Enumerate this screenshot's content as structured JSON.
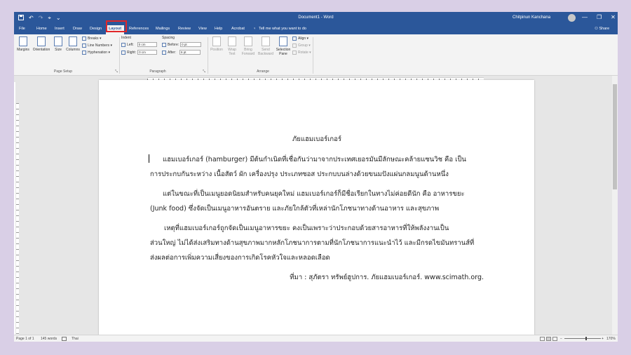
{
  "titlebar": {
    "save_icon": "save-icon",
    "undo_glyph": "↶",
    "redo_glyph": "↷",
    "touch_glyph": "⌖",
    "qa_more_glyph": "⌄",
    "document_title": "Document1 - Word",
    "user_name": "Chitpinun Kanchana",
    "minimize_glyph": "—",
    "maximize_glyph": "❐",
    "close_glyph": "✕"
  },
  "tabs": [
    "File",
    "Home",
    "Insert",
    "Draw",
    "Design",
    "Layout",
    "References",
    "Mailings",
    "Review",
    "View",
    "Help",
    "Acrobat"
  ],
  "active_tab": "Layout",
  "tell_me": {
    "icon": "lightbulb-icon",
    "glyph": "♀",
    "text": "Tell me what you want to do"
  },
  "share": {
    "icon": "person-icon",
    "glyph": "⚇",
    "label": "Share"
  },
  "ribbon": {
    "page_setup": {
      "label": "Page Setup",
      "margins": "Margins",
      "orientation": "Orientation",
      "size": "Size",
      "columns": "Columns",
      "breaks": "Breaks ▾",
      "line_numbers": "Line Numbers ▾",
      "hyphenation": "Hyphenation ▾"
    },
    "paragraph": {
      "label": "Paragraph",
      "indent_label": "Indent",
      "spacing_label": "Spacing",
      "left_label": "Left:",
      "left_value": "0 cm",
      "right_label": "Right:",
      "right_value": "0 cm",
      "before_label": "Before:",
      "before_value": "0 pt",
      "after_label": "After:",
      "after_value": "6 pt"
    },
    "arrange": {
      "label": "Arrange",
      "position": "Position",
      "wrap_text": "Wrap Text",
      "bring_forward": "Bring Forward",
      "send_backward": "Send Backward",
      "selection_pane": "Selection Pane",
      "align": "Align ▾",
      "group": "Group ▾",
      "rotate": "Rotate ▾"
    },
    "launcher_glyph": "⤡"
  },
  "document": {
    "title": "ภัยแฮมเบอร์เกอร์",
    "lines": [
      "แฮมเบอร์เกอร์ (hamburger) มีต้นกำเนิดที่เชื่อกันว่ามาจากประเทศเยอรมันมีลักษณะคล้ายแซนวิช คือ เป็น",
      "การประกบกันระหว่าง เนื้อสัตว์ ผัก เครื่องปรุง ประเภทซอส ประกบบนล่างด้วยขนมปังแผ่นกลมนูนด้านหนึ่ง",
      "แต่ในขณะที่เป็นเมนูยอดนิยมสำหรับคนยุคใหม่ แฮมเบอร์เกอร์ก็มีชื่อเรียกในทางไม่ค่อยดีนัก คือ  อาหารขยะ",
      "(Junk food) ซึ่งจัดเป็นเมนูอาหารอันตราย และภัยใกล้ตัวที่เหล่านักโภชนาทางด้านอาหาร และสุขภาพ",
      "เหตุที่แฮมเบอร์เกอร์ถูกจัดเป็นเมนูอาหารขยะ คงเป็นเพราะว่าประกอบด้วยสารอาหารที่ให้พลังงานเป็น",
      "ส่วนใหญ่ ไม่ได้ส่งเสริมทางด้านสุขภาพมากหลักโภชนาการตามที่นักโภชนาการแนะนำไว้ และมีกรดไขมันทรานส์ที่",
      "ส่งผลต่อการเพิ่มความเสี่ยงของการเกิดโรคหัวใจและหลอดเลือด"
    ],
    "source": "ที่มา : สุภัตรา ทรัพย์ฮูปการ. ภัยแฮมเบอร์เกอร์. www.scimath.org."
  },
  "statusbar": {
    "page": "Page 1 of 1",
    "words": "145 words",
    "proofing_icon": "proofing-icon",
    "language": "Thai",
    "zoom_minus": "−",
    "zoom_plus": "+",
    "zoom": "170%"
  }
}
